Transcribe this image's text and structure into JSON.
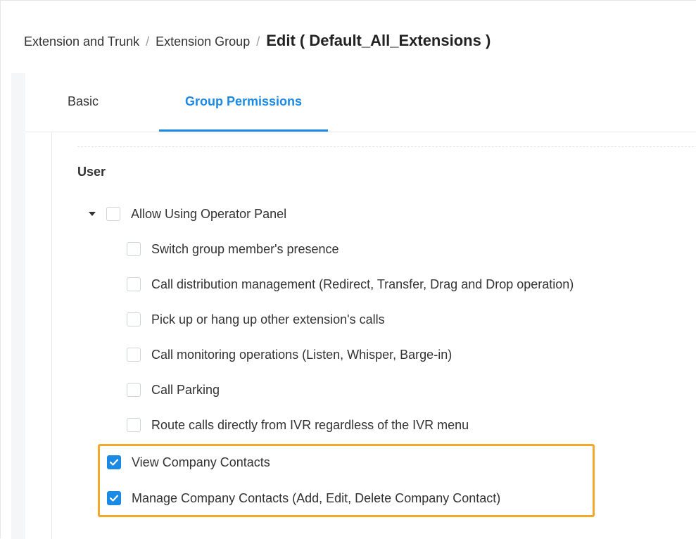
{
  "breadcrumb": {
    "level1": "Extension and Trunk",
    "separator": "/",
    "level2": "Extension Group",
    "current": "Edit ( Default_All_Extensions )"
  },
  "tabs": [
    {
      "label": "Basic",
      "active": false
    },
    {
      "label": "Group Permissions",
      "active": true
    }
  ],
  "section": {
    "title": "User"
  },
  "parent_permission": {
    "label": "Allow Using Operator Panel",
    "checked": false,
    "expanded": true
  },
  "sub_permissions": [
    {
      "label": "Switch group member's presence",
      "checked": false
    },
    {
      "label": "Call distribution management (Redirect, Transfer, Drag and Drop operation)",
      "checked": false
    },
    {
      "label": "Pick up or hang up other extension's calls",
      "checked": false
    },
    {
      "label": "Call monitoring operations (Listen, Whisper, Barge-in)",
      "checked": false
    },
    {
      "label": "Call Parking",
      "checked": false
    },
    {
      "label": "Route calls directly from IVR regardless of the IVR menu",
      "checked": false
    }
  ],
  "contact_permissions": [
    {
      "label": "View Company Contacts",
      "checked": true
    },
    {
      "label": "Manage Company Contacts (Add, Edit, Delete Company Contact)",
      "checked": true
    }
  ],
  "colors": {
    "accent": "#1a8ae5",
    "highlight_border": "#f0a928"
  },
  "icons": {
    "expand": "caret-down-icon",
    "check": "checkmark-icon"
  }
}
